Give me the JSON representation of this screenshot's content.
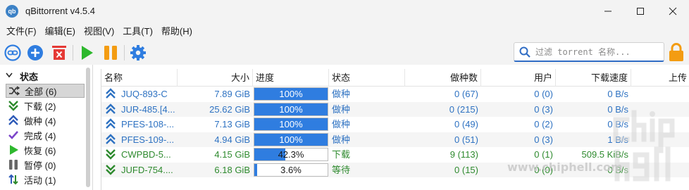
{
  "window": {
    "title": "qBittorrent v4.5.4",
    "logo_text": "qb",
    "minimize": "—",
    "maximize": "☐",
    "close": "✕"
  },
  "menu": [
    "文件(F)",
    "编辑(E)",
    "视图(V)",
    "工具(T)",
    "帮助(H)"
  ],
  "toolbar": {
    "icons": [
      "link-icon",
      "plus-icon",
      "delete-icon",
      "play-icon",
      "pause-icon",
      "gear-icon"
    ],
    "search_placeholder": "过滤 torrent 名称...",
    "accent": "#2f6cc4"
  },
  "sidebar": {
    "header": "状态",
    "items": [
      {
        "label": "全部 (6)",
        "icon": "shuffle-icon",
        "selected": true
      },
      {
        "label": "下载 (2)",
        "icon": "download-icon"
      },
      {
        "label": "做种 (4)",
        "icon": "upload-icon"
      },
      {
        "label": "完成 (4)",
        "icon": "check-icon"
      },
      {
        "label": "恢复 (6)",
        "icon": "play-icon"
      },
      {
        "label": "暂停 (0)",
        "icon": "pause-icon"
      },
      {
        "label": "活动 (1)",
        "icon": "activity-icon"
      }
    ]
  },
  "table": {
    "columns": [
      "名称",
      "大小",
      "进度",
      "状态",
      "做种数",
      "用户",
      "下载速度",
      "上传"
    ],
    "rows": [
      {
        "name": "JUQ-893-C",
        "size": "7.89 GiB",
        "progress": 1.0,
        "progress_text": "100%",
        "status": "做种",
        "seeds": "0 (67)",
        "peers": "0 (0)",
        "speed": "0 B/s",
        "kind": "seed"
      },
      {
        "name": "JUR-485.[4...",
        "size": "25.62 GiB",
        "progress": 1.0,
        "progress_text": "100%",
        "status": "做种",
        "seeds": "0 (215)",
        "peers": "0 (3)",
        "speed": "0 B/s",
        "kind": "seed"
      },
      {
        "name": "PFES-108-...",
        "size": "7.13 GiB",
        "progress": 1.0,
        "progress_text": "100%",
        "status": "做种",
        "seeds": "0 (49)",
        "peers": "0 (2)",
        "speed": "0 B/s",
        "kind": "seed"
      },
      {
        "name": "PFES-109-...",
        "size": "4.94 GiB",
        "progress": 1.0,
        "progress_text": "100%",
        "status": "做种",
        "seeds": "0 (51)",
        "peers": "0 (3)",
        "speed": "1 B/s",
        "kind": "seed"
      },
      {
        "name": "CWPBD-5...",
        "size": "4.15 GiB",
        "progress": 0.423,
        "progress_text": "42.3%",
        "status": "下载",
        "seeds": "9 (113)",
        "peers": "0 (1)",
        "speed": "509.5 KiB/s",
        "kind": "dl"
      },
      {
        "name": "JUFD-754....",
        "size": "6.18 GiB",
        "progress": 0.036,
        "progress_text": "3.6%",
        "status": "等待",
        "seeds": "0 (15)",
        "peers": "0 (0)",
        "speed": "0 B/s",
        "kind": "wait"
      }
    ]
  },
  "watermark": {
    "logo_text": "chiphell",
    "url": "www.chiphell.com"
  },
  "colors": {
    "progress": "#2f7de0",
    "seed_text": "#2e72c2",
    "download_text": "#2e8a2e",
    "lock": "#f39c12"
  }
}
